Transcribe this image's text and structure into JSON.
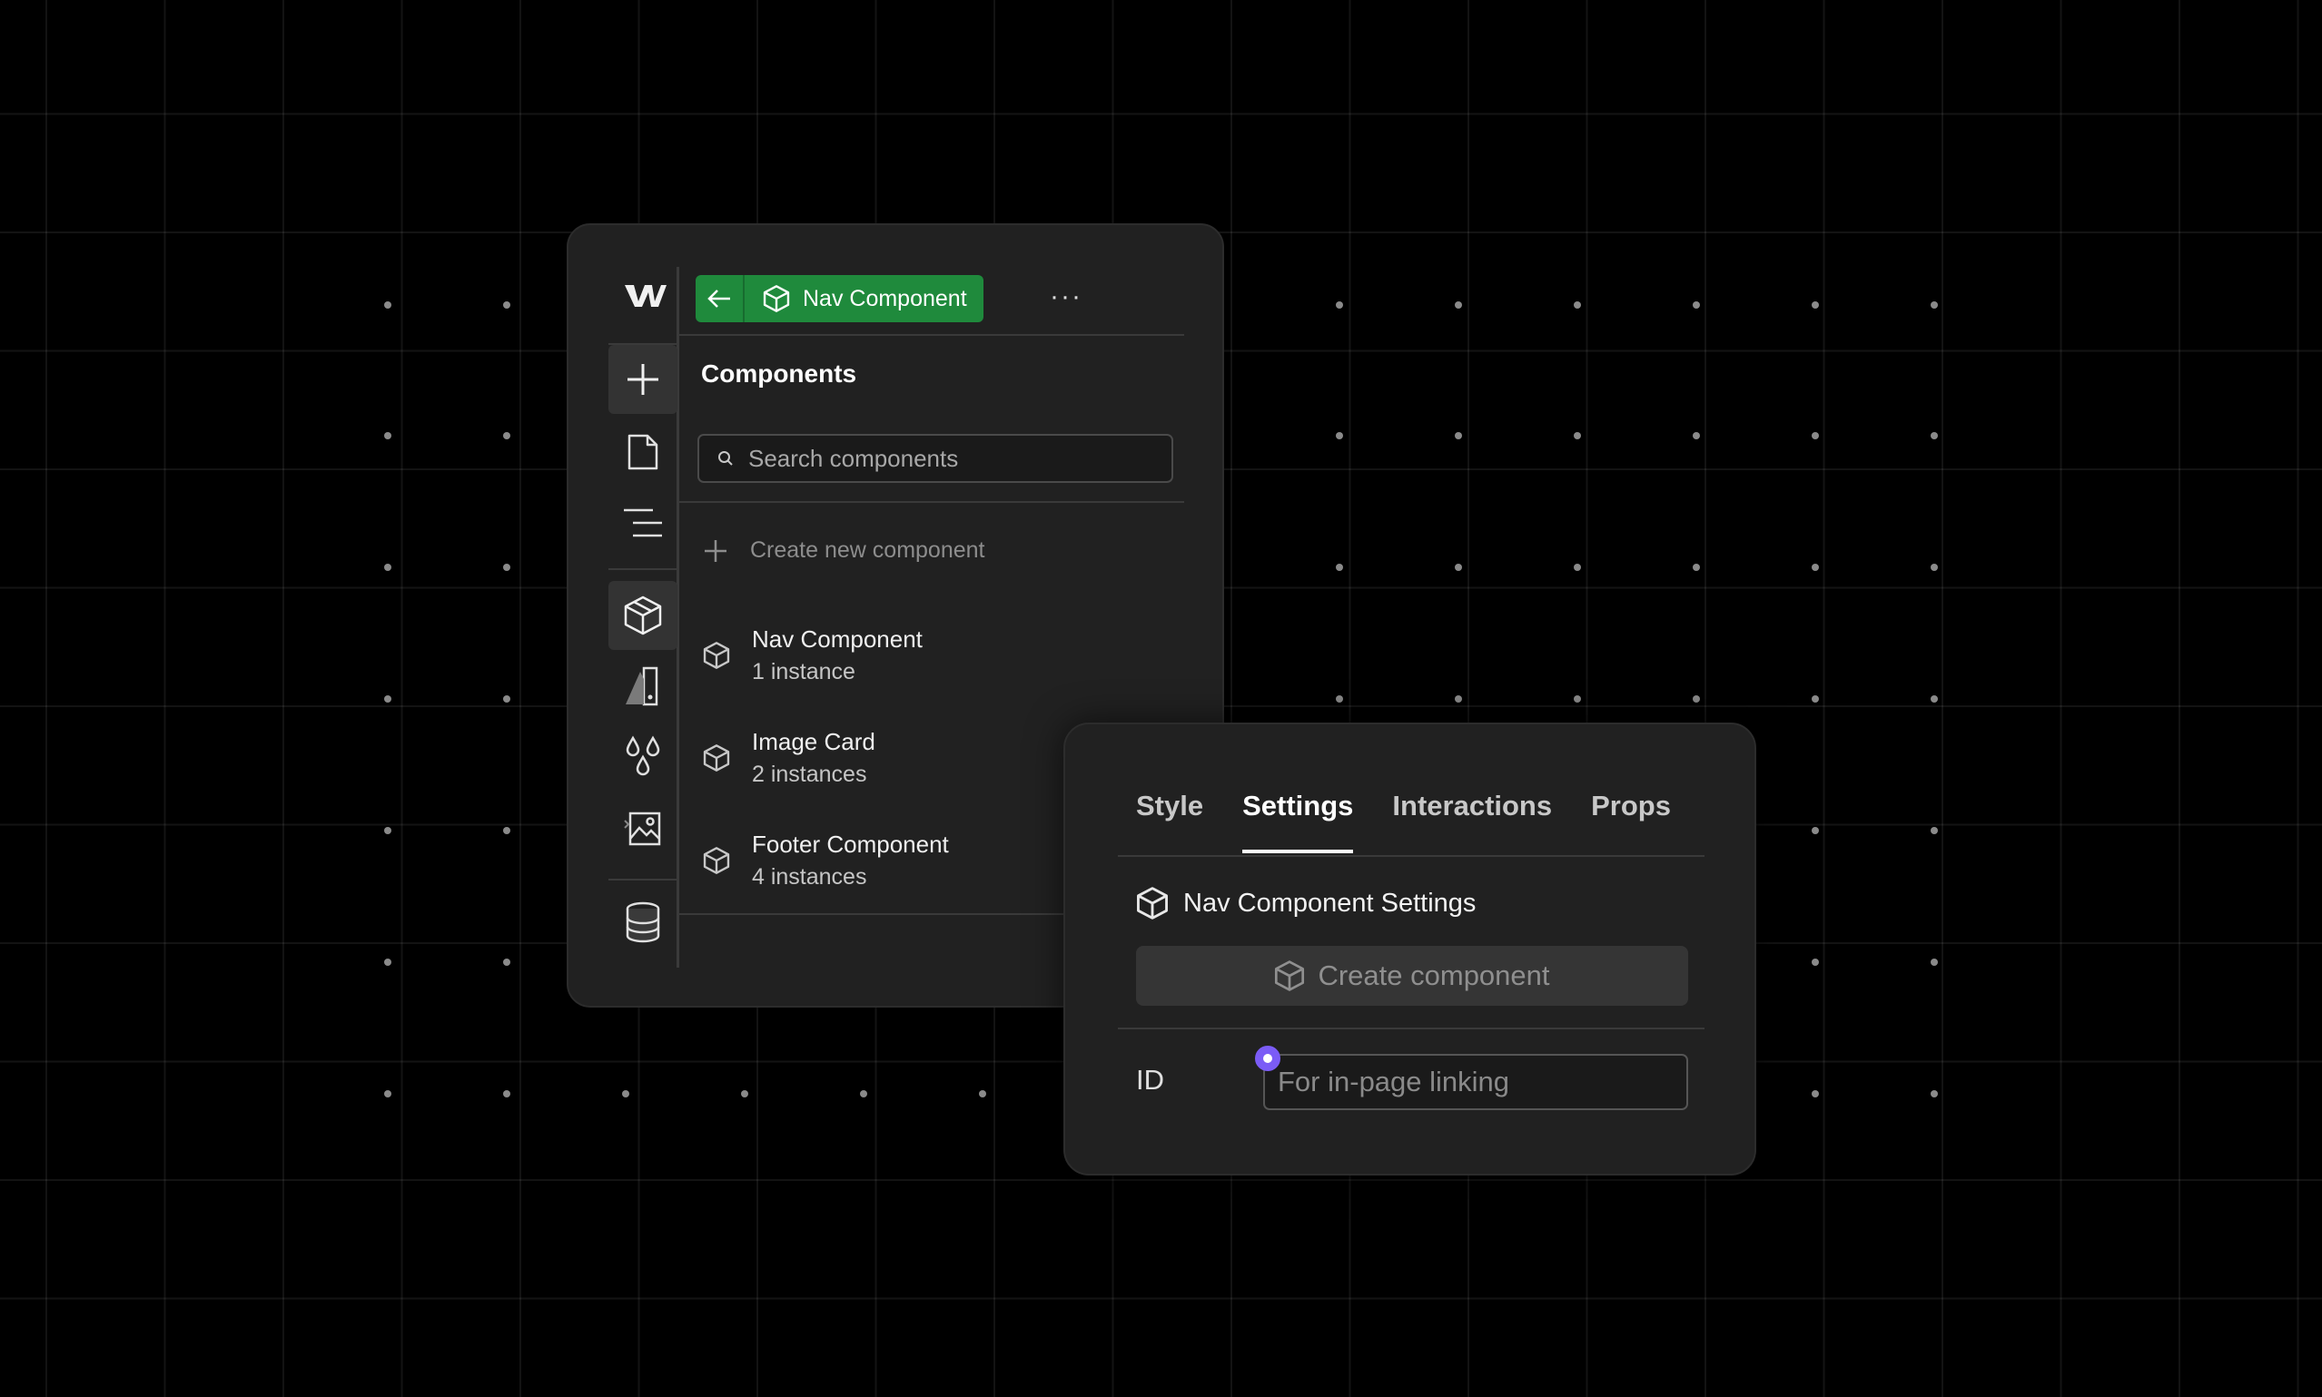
{
  "colors": {
    "accent_green": "#1f8a3c",
    "panel_bg": "#212121",
    "page_bg": "#000000",
    "focus_dot": "#7b5cf6"
  },
  "left_panel": {
    "rail": {
      "items": [
        {
          "icon": "webflow-logo-icon"
        },
        {
          "icon": "plus-icon",
          "active": true
        },
        {
          "icon": "page-icon"
        },
        {
          "icon": "navigator-lines-icon"
        },
        {
          "icon": "components-cube-icon",
          "active": true
        },
        {
          "icon": "style-manager-icon"
        },
        {
          "icon": "variables-drops-icon"
        },
        {
          "icon": "assets-image-icon"
        },
        {
          "icon": "cms-database-icon"
        }
      ]
    },
    "header": {
      "back_icon": "arrow-left-icon",
      "component_name": "Nav Component",
      "more_label": "···"
    },
    "title": "Components",
    "search": {
      "placeholder": "Search components"
    },
    "create_new_label": "Create new component",
    "components": [
      {
        "name": "Nav Component",
        "count": "1 instance"
      },
      {
        "name": "Image Card",
        "count": "2 instances"
      },
      {
        "name": "Footer Component",
        "count": "4 instances"
      }
    ]
  },
  "right_panel": {
    "tabs": [
      {
        "label": "Style"
      },
      {
        "label": "Settings",
        "active": true
      },
      {
        "label": "Interactions"
      },
      {
        "label": "Props"
      }
    ],
    "settings_title": "Nav Component Settings",
    "create_component_label": "Create component",
    "id_field": {
      "label": "ID",
      "placeholder": "For in-page linking"
    }
  }
}
